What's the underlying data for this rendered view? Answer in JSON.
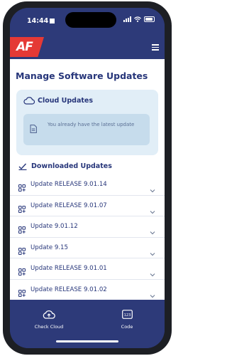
{
  "status_bar": {
    "time": "14:44"
  },
  "app_bar": {
    "logo_text": "AF"
  },
  "page": {
    "title": "Manage Software Updates"
  },
  "cloud": {
    "label": "Cloud Updates",
    "notice": "You already have the latest update"
  },
  "downloaded": {
    "label": "Downloaded Updates",
    "items": [
      {
        "label": "Update RELEASE 9.01.14"
      },
      {
        "label": "Update RELEASE 9.01.07"
      },
      {
        "label": "Update 9.01.12"
      },
      {
        "label": "Update 9.15"
      },
      {
        "label": "Update RELEASE 9.01.01"
      },
      {
        "label": "Update RELEASE 9.01.02"
      }
    ]
  },
  "bottom_nav": {
    "check_cloud": "Check Cloud",
    "code": "Code",
    "code_icon_text": "123"
  },
  "colors": {
    "brand_navy": "#2d3a79",
    "logo_red": "#e53935",
    "card_bg": "#e1eef7",
    "notice_bg": "#c6dcec"
  }
}
